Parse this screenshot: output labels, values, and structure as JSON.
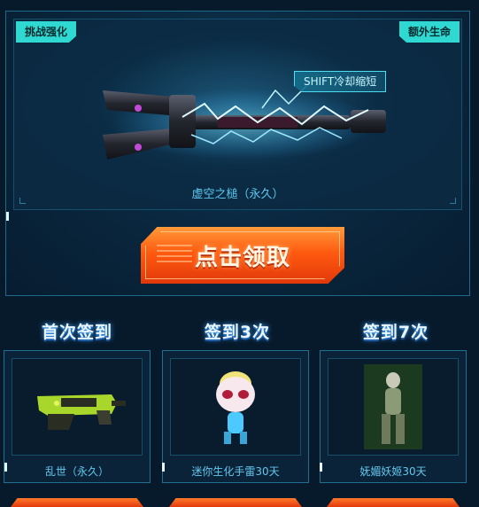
{
  "main_reward": {
    "tag_left": "挑战强化",
    "tag_right": "额外生命",
    "skill_tip": "SHIFT冷却缩短",
    "item_name": "虚空之槌（永久）",
    "claim_label": "点击领取"
  },
  "signin_rewards": [
    {
      "title": "首次签到",
      "item_name": "乱世（永久）",
      "icon": "smg-weapon-icon"
    },
    {
      "title": "签到3次",
      "item_name": "迷你生化手雷30天",
      "icon": "mini-character-icon"
    },
    {
      "title": "签到7次",
      "item_name": "妩媚妖姬30天",
      "icon": "female-character-icon"
    }
  ],
  "colors": {
    "accent_cyan": "#2fd8d0",
    "button_orange": "#ff5a10",
    "label_blue": "#64c7ee",
    "background": "#071a2c"
  }
}
